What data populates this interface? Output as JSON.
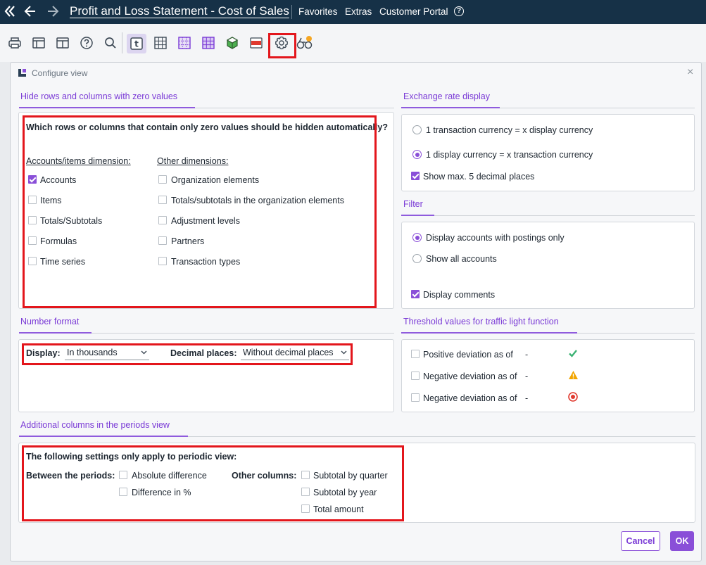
{
  "topbar": {
    "collapse_icon": "double-chevron-left-icon",
    "back_icon": "arrow-left-icon",
    "forward_icon": "arrow-right-icon",
    "title": "Profit and Loss Statement - Cost of Sales",
    "menu": [
      "Favorites",
      "Extras",
      "Customer Portal"
    ],
    "help_icon": "question-circle-icon"
  },
  "toolbar": {
    "icons": [
      "printer-icon",
      "layout-icon",
      "layout-split-icon",
      "help-icon",
      "search-icon",
      "text-view-icon",
      "grid-icon",
      "grid-dots-icon",
      "grid-purple-icon",
      "cube-icon",
      "flag-icon",
      "settings-gear-icon",
      "binoculars-icon"
    ],
    "text_view_glyph": "t"
  },
  "dialog": {
    "title": "Configure view",
    "close_glyph": "×",
    "zero_values": {
      "title": "Hide rows and columns with zero values",
      "question": "Which rows or columns that contain only zero values should be hidden automatically?",
      "accounts_heading": "Accounts/items dimension:",
      "accounts_items": [
        {
          "label": "Accounts",
          "checked": true
        },
        {
          "label": "Items",
          "checked": false
        },
        {
          "label": "Totals/Subtotals",
          "checked": false
        },
        {
          "label": "Formulas",
          "checked": false
        },
        {
          "label": "Time series",
          "checked": false
        }
      ],
      "other_heading": "Other dimensions:",
      "other_items": [
        {
          "label": "Organization elements",
          "checked": false
        },
        {
          "label": "Totals/subtotals in the organization elements",
          "checked": false
        },
        {
          "label": "Adjustment levels",
          "checked": false
        },
        {
          "label": "Partners",
          "checked": false
        },
        {
          "label": "Transaction types",
          "checked": false
        }
      ]
    },
    "exchange_rate": {
      "title": "Exchange rate display",
      "options": [
        {
          "label": "1 transaction currency = x display currency",
          "selected": false
        },
        {
          "label": "1 display currency = x transaction currency",
          "selected": true
        }
      ],
      "decimals_label": "Show max. 5 decimal places",
      "decimals_checked": true
    },
    "filter": {
      "title": "Filter",
      "options": [
        {
          "label": "Display accounts with postings only",
          "selected": true
        },
        {
          "label": "Show all accounts",
          "selected": false
        }
      ],
      "comments_label": "Display comments",
      "comments_checked": true
    },
    "number_format": {
      "title": "Number format",
      "display_label": "Display:",
      "display_value": "In thousands",
      "decimal_label": "Decimal places:",
      "decimal_value": "Without decimal places"
    },
    "threshold": {
      "title": "Threshold values for traffic light function",
      "rows": [
        {
          "label": "Positive deviation as of",
          "value": "-",
          "icon": "check-green-icon",
          "color": "#3bb273"
        },
        {
          "label": "Negative deviation as of",
          "value": "-",
          "icon": "warning-triangle-icon",
          "color": "#f2a500"
        },
        {
          "label": "Negative deviation as of",
          "value": "-",
          "icon": "stop-red-icon",
          "color": "#e03a2f"
        }
      ]
    },
    "additional": {
      "title": "Additional columns in the periods view",
      "note": "The following settings only apply to periodic view:",
      "between_label": "Between the periods:",
      "between_items": [
        {
          "label": "Absolute difference",
          "checked": false
        },
        {
          "label": "Difference in %",
          "checked": false
        }
      ],
      "other_label": "Other columns:",
      "other_items": [
        {
          "label": "Subtotal by quarter",
          "checked": false
        },
        {
          "label": "Subtotal by year",
          "checked": false
        },
        {
          "label": "Total amount",
          "checked": false
        }
      ]
    },
    "buttons": {
      "cancel": "Cancel",
      "ok": "OK"
    }
  },
  "colors": {
    "accent": "#8a4fd8",
    "nav_bg": "#163147",
    "highlight": "#e3161c"
  }
}
